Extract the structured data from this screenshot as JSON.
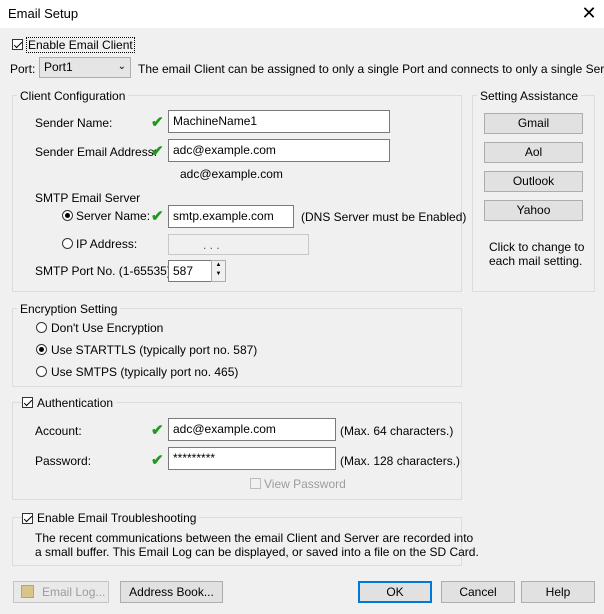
{
  "window": {
    "title": "Email Setup",
    "close_glyph": "✕"
  },
  "enable_email_client": {
    "label": "Enable Email Client",
    "checked": true
  },
  "port": {
    "label": "Port:",
    "value": "Port1",
    "note": "The email Client can be assigned to only a single Port and connects to only a single Server."
  },
  "client_config": {
    "legend": "Client Configuration",
    "sender_name": {
      "label": "Sender Name:",
      "value": "MachineName1"
    },
    "sender_email": {
      "label": "Sender Email Address:",
      "value": "adc@example.com",
      "preview": "adc@example.com"
    },
    "smtp_server": {
      "legend": "SMTP Email Server",
      "server_name_label": "Server Name:",
      "server_name_value": "smtp.example.com",
      "server_name_note": "(DNS Server must be Enabled)",
      "ip_label": "IP Address:",
      "ip_value": ".          .          ."
    },
    "smtp_port": {
      "label": "SMTP Port No. (1-65535)",
      "value": "587"
    }
  },
  "setting_assistance": {
    "legend": "Setting Assistance",
    "buttons": [
      "Gmail",
      "Aol",
      "Outlook",
      "Yahoo"
    ],
    "hint_line1": "Click to change to",
    "hint_line2": "each mail setting."
  },
  "encryption": {
    "legend": "Encryption Setting",
    "options": [
      "Don't Use Encryption",
      "Use STARTTLS (typically port no. 587)",
      "Use SMTPS (typically port no. 465)"
    ],
    "selected_index": 1
  },
  "authentication": {
    "legend": "Authentication",
    "checked": true,
    "account_label": "Account:",
    "account_value": "adc@example.com",
    "account_note": "(Max. 64 characters.)",
    "password_label": "Password:",
    "password_value": "*********",
    "password_note": "(Max. 128 characters.)",
    "view_password_label": "View Password"
  },
  "troubleshooting": {
    "legend": "Enable Email Troubleshooting",
    "checked": true,
    "text_line1": "The recent communications between the email Client and Server are recorded into",
    "text_line2": "a small buffer. This Email Log can be displayed, or saved into a file on the SD Card."
  },
  "footer": {
    "email_log": "Email Log...",
    "address_book": "Address Book...",
    "ok": "OK",
    "cancel": "Cancel",
    "help": "Help"
  },
  "colors": {
    "ok_accent": "#0078d7",
    "valid_check": "#1f9a1f"
  }
}
